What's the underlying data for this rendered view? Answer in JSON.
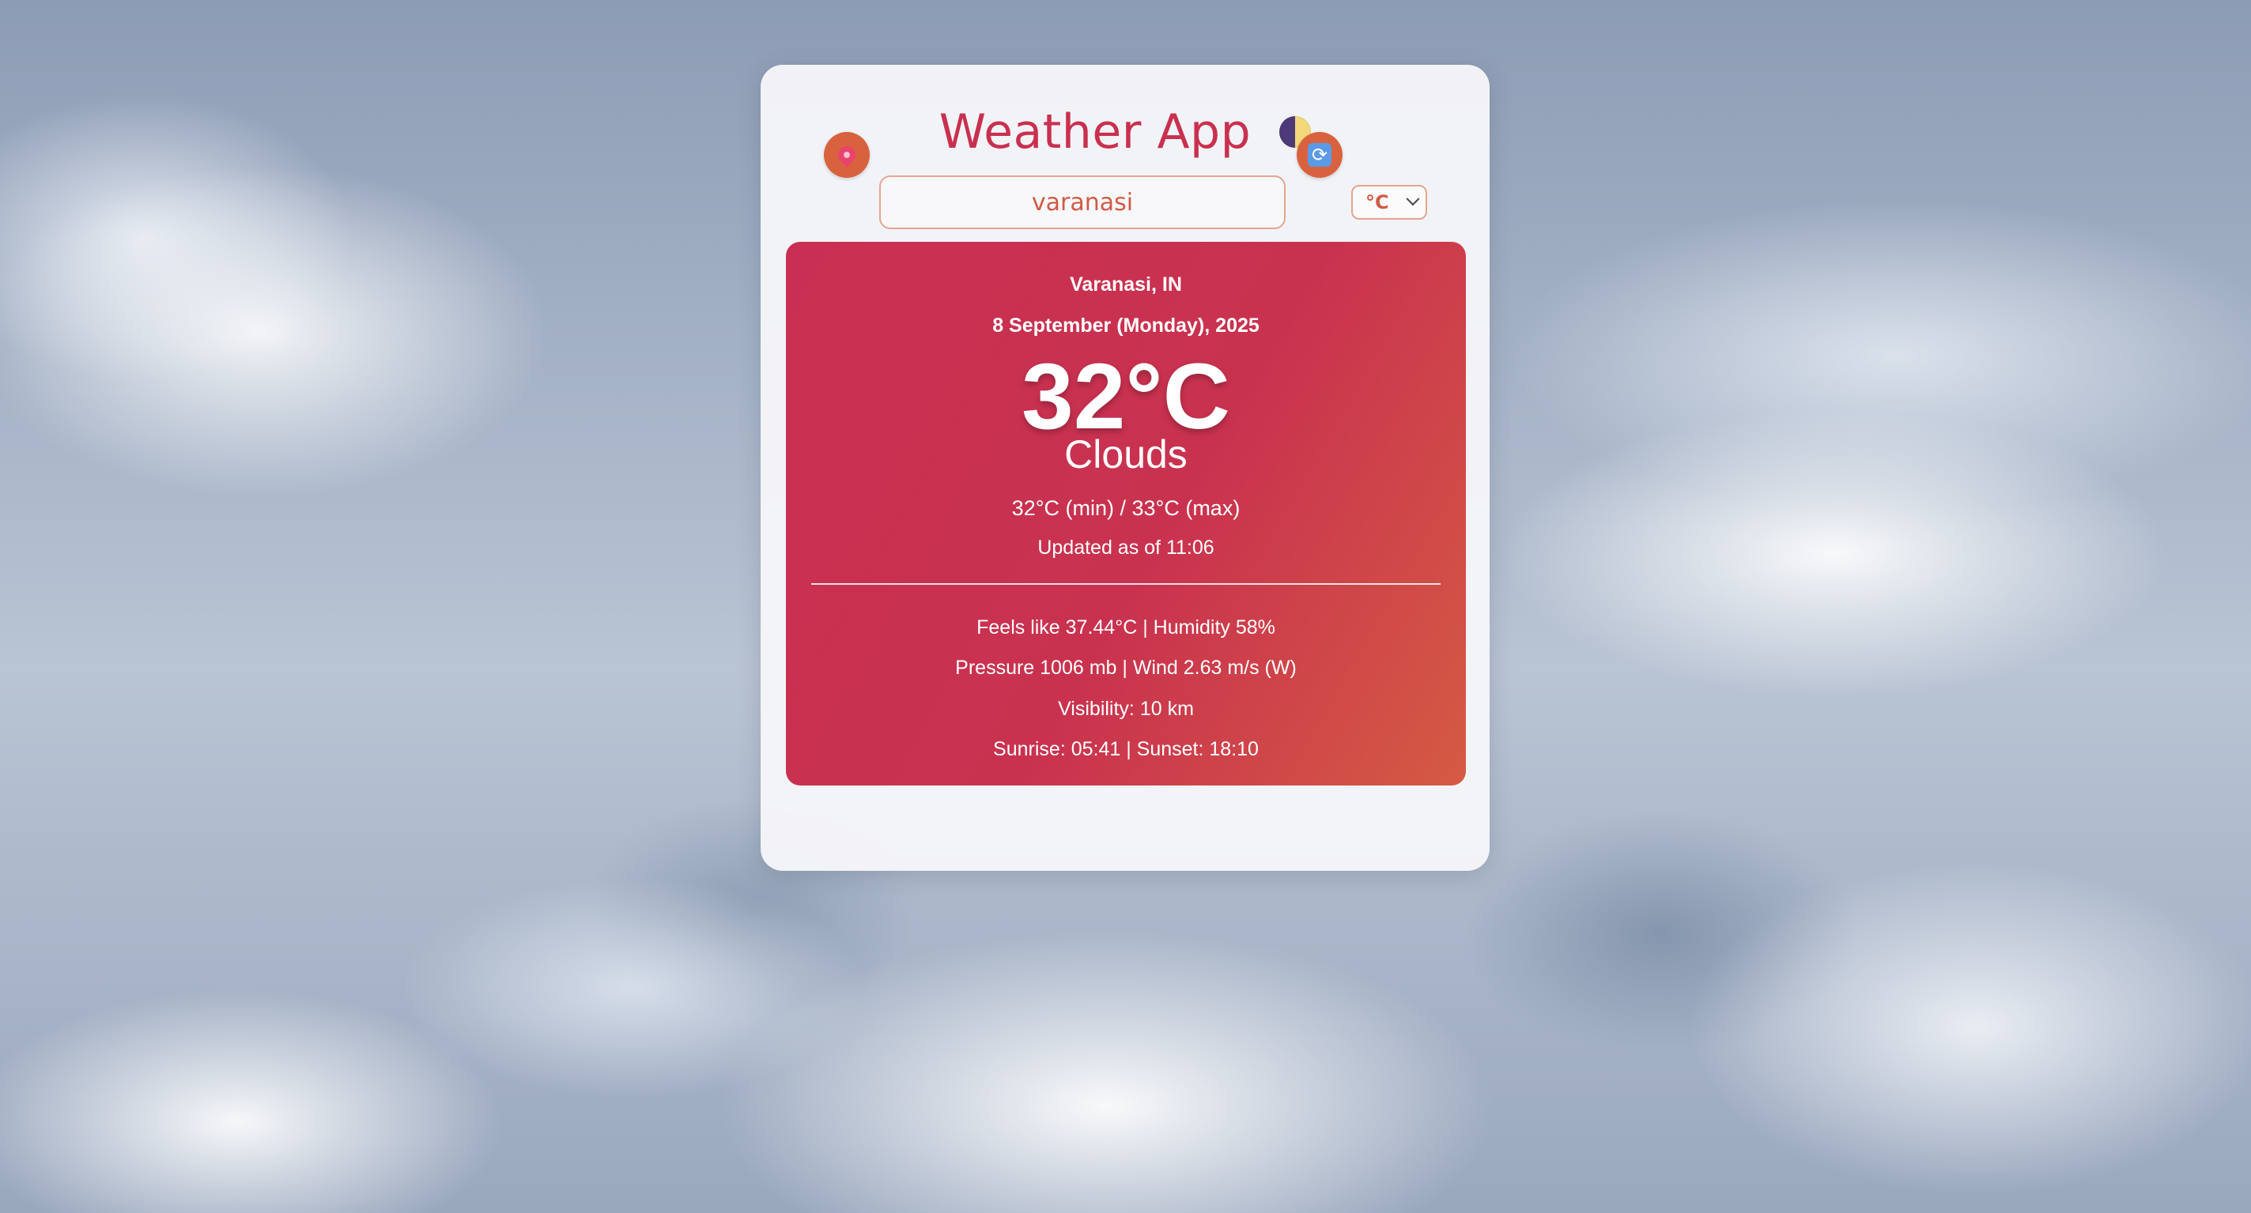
{
  "app": {
    "title": "Weather App",
    "theme_toggle_icon": "half-moon-icon"
  },
  "search": {
    "value": "varanasi",
    "location_icon": "map-pin-icon",
    "refresh_icon": "refresh-icon"
  },
  "unit_select": {
    "selected": "°C"
  },
  "weather": {
    "city": "Varanasi, IN",
    "date": "8 September (Monday), 2025",
    "temperature": "32°C",
    "condition": "Clouds",
    "min_max": "32°C (min) / 33°C (max)",
    "updated": "Updated as of 11:06",
    "feels_humidity": "Feels like 37.44°C | Humidity 58%",
    "pressure_wind": "Pressure 1006 mb | Wind 2.63 m/s (W)",
    "visibility": "Visibility: 10 km",
    "sun": "Sunrise: 05:41 | Sunset: 18:10"
  },
  "colors": {
    "accent": "#c9304f",
    "button": "#d9623e",
    "card_gradient_start": "#c92f52",
    "card_gradient_end": "#d55a43"
  }
}
